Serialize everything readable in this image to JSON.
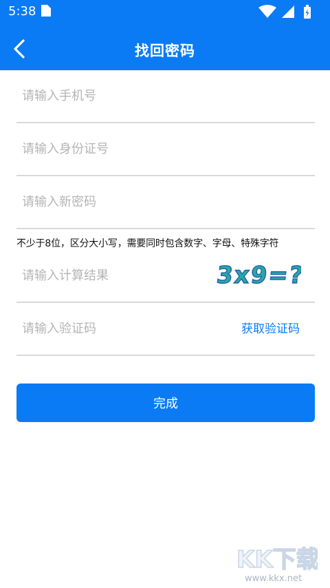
{
  "colors": {
    "accent": "#0a7bf5"
  },
  "status_bar": {
    "time": "5:38",
    "icons": [
      "sim-card-icon",
      "wifi-icon",
      "cell-signal-icon",
      "battery-icon"
    ]
  },
  "header": {
    "title": "找回密码",
    "back_icon": "chevron-left-icon"
  },
  "form": {
    "phone": {
      "placeholder": "请输入手机号",
      "value": ""
    },
    "id_number": {
      "placeholder": "请输入身份证号",
      "value": ""
    },
    "new_password": {
      "placeholder": "请输入新密码",
      "value": ""
    },
    "password_hint": "不少于8位，区分大小写，需要同时包含数字、字母、特殊字符",
    "calc_result": {
      "placeholder": "请输入计算结果",
      "value": ""
    },
    "captcha_text": "3x9=?",
    "sms_code": {
      "placeholder": "请输入验证码",
      "value": ""
    },
    "get_code_label": "获取验证码",
    "submit_label": "完成"
  },
  "watermark": {
    "logo_text": "KK下载",
    "url": "www.kkx.net"
  }
}
